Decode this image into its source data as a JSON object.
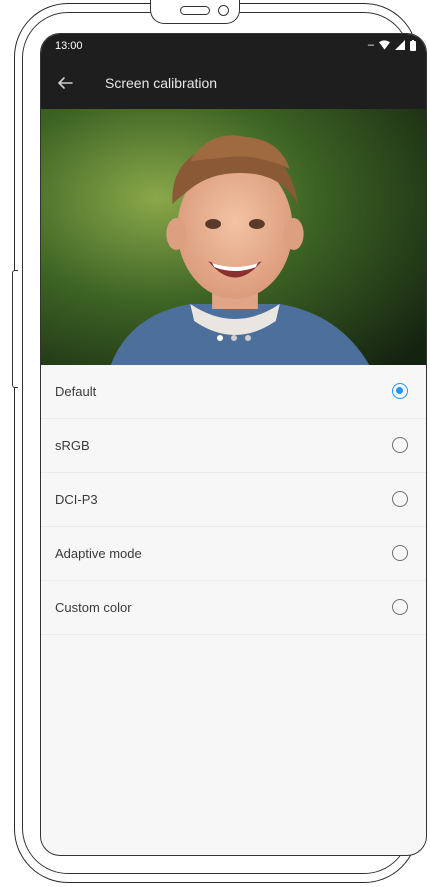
{
  "status_bar": {
    "time": "13:00"
  },
  "app_bar": {
    "title": "Screen calibration"
  },
  "carousel": {
    "pages": 3,
    "active_page": 1
  },
  "options": [
    {
      "label": "Default",
      "selected": true
    },
    {
      "label": "sRGB",
      "selected": false
    },
    {
      "label": "DCI-P3",
      "selected": false
    },
    {
      "label": "Adaptive mode",
      "selected": false
    },
    {
      "label": "Custom color",
      "selected": false
    }
  ],
  "colors": {
    "accent": "#2196f3",
    "app_bar_bg": "#1e1e1e",
    "list_bg": "#f7f7f7"
  },
  "icons": {
    "back": "arrow-back-icon",
    "wifi": "wifi-icon",
    "signal": "signal-icon",
    "battery": "battery-icon"
  }
}
